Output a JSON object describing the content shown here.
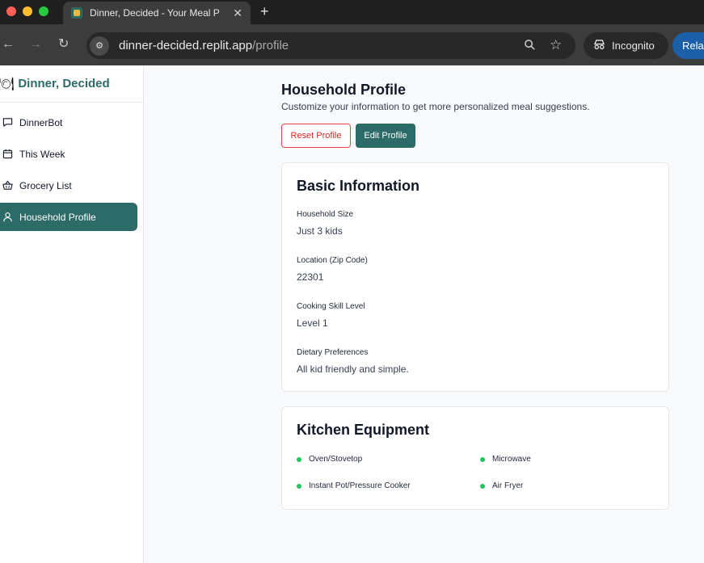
{
  "browser": {
    "tab_title": "Dinner, Decided - Your Meal P",
    "url_host": "dinner-decided.replit.app",
    "url_path": "/profile",
    "incognito_label": "Incognito",
    "relaunch_label": "Rela"
  },
  "sidebar": {
    "brand": "Dinner, Decided",
    "items": [
      {
        "label": "DinnerBot",
        "icon": "chat-icon"
      },
      {
        "label": "This Week",
        "icon": "calendar-icon"
      },
      {
        "label": "Grocery List",
        "icon": "basket-icon"
      },
      {
        "label": "Household Profile",
        "icon": "user-icon",
        "active": true
      }
    ]
  },
  "page": {
    "title": "Household Profile",
    "subtitle": "Customize your information to get more personalized meal suggestions.",
    "reset_label": "Reset Profile",
    "edit_label": "Edit Profile"
  },
  "basic": {
    "heading": "Basic Information",
    "fields": [
      {
        "label": "Household Size",
        "value": "Just 3 kids"
      },
      {
        "label": "Location (Zip Code)",
        "value": "22301"
      },
      {
        "label": "Cooking Skill Level",
        "value": "Level 1"
      },
      {
        "label": "Dietary Preferences",
        "value": "All kid friendly and simple."
      }
    ]
  },
  "kitchen": {
    "heading": "Kitchen Equipment",
    "items": [
      "Oven/Stovetop",
      "Microwave",
      "Instant Pot/Pressure Cooker",
      "Air Fryer"
    ]
  },
  "colors": {
    "brand": "#2d6b68",
    "danger": "#dc2626",
    "equipment_dot": "#22c55e"
  }
}
